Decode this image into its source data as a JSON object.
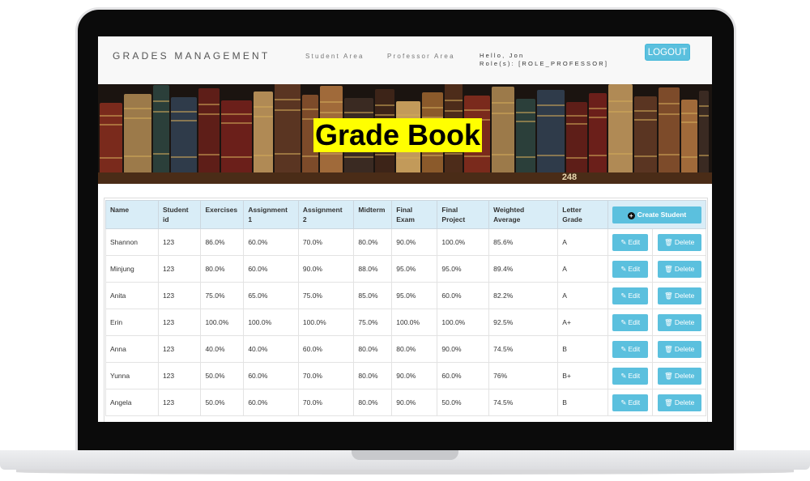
{
  "header": {
    "brand": "GRADES MANAGEMENT",
    "nav": [
      "Student Area",
      "Professor Area"
    ],
    "greeting": "Hello, Jon",
    "roles": "Role(s): [ROLE_PROFESSOR]",
    "logout_label": "LOGOUT"
  },
  "banner": {
    "title": "Grade Book",
    "shelf_number": "248"
  },
  "table": {
    "columns": [
      [
        "Name",
        ""
      ],
      [
        "Student",
        "id"
      ],
      [
        "Exercises",
        ""
      ],
      [
        "Assignment",
        "1"
      ],
      [
        "Assignment",
        "2"
      ],
      [
        "Midterm",
        ""
      ],
      [
        "Final",
        "Exam"
      ],
      [
        "Final",
        "Project"
      ],
      [
        "Weighted",
        "Average"
      ],
      [
        "Letter",
        "Grade"
      ]
    ],
    "create_label": "Create Student",
    "edit_label": "Edit",
    "delete_label": "Delete",
    "rows": [
      [
        "Shannon",
        "123",
        "86.0%",
        "60.0%",
        "70.0%",
        "80.0%",
        "90.0%",
        "100.0%",
        "85.6%",
        "A"
      ],
      [
        "Minjung",
        "123",
        "80.0%",
        "60.0%",
        "90.0%",
        "88.0%",
        "95.0%",
        "95.0%",
        "89.4%",
        "A"
      ],
      [
        "Anita",
        "123",
        "75.0%",
        "65.0%",
        "75.0%",
        "85.0%",
        "95.0%",
        "60.0%",
        "82.2%",
        "A"
      ],
      [
        "Erin",
        "123",
        "100.0%",
        "100.0%",
        "100.0%",
        "75.0%",
        "100.0%",
        "100.0%",
        "92.5%",
        "A+"
      ],
      [
        "Anna",
        "123",
        "40.0%",
        "40.0%",
        "60.0%",
        "80.0%",
        "80.0%",
        "90.0%",
        "74.5%",
        "B"
      ],
      [
        "Yunna",
        "123",
        "50.0%",
        "60.0%",
        "70.0%",
        "80.0%",
        "90.0%",
        "60.0%",
        "76%",
        "B+"
      ],
      [
        "Angela",
        "123",
        "50.0%",
        "60.0%",
        "70.0%",
        "80.0%",
        "90.0%",
        "50.0%",
        "74.5%",
        "B"
      ]
    ]
  },
  "icons": {
    "plus": "plus-circle-icon",
    "edit": "pencil-square-icon",
    "delete": "trash-icon"
  },
  "colors": {
    "accent": "#5bc0de",
    "table_header": "#d9edf7",
    "banner_highlight": "#ffff00"
  }
}
